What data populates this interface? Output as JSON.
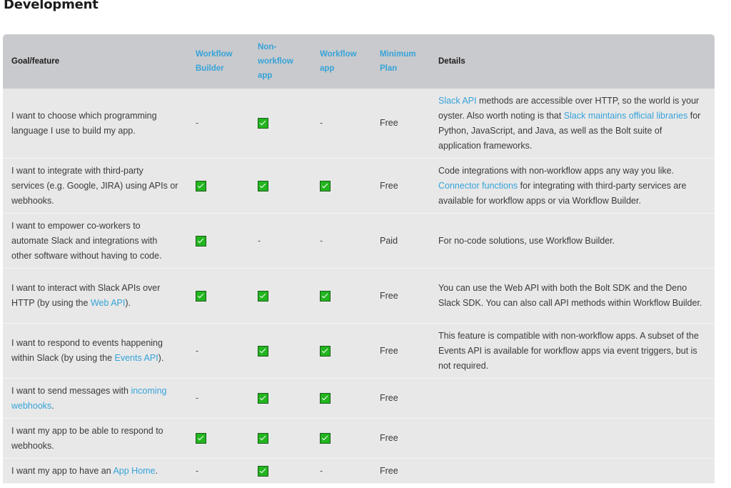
{
  "heading": "Development",
  "table": {
    "headers": {
      "goal": "Goal/feature",
      "workflow_builder": "Workflow Builder",
      "non_workflow_app": "Non-workflow app",
      "workflow_app": "Workflow app",
      "minimum_plan": "Minimum Plan",
      "details": "Details"
    },
    "rows": [
      {
        "goal": {
          "pre": "I want to choose which programming language I use to build my app.",
          "link": "",
          "post": ""
        },
        "workflow_builder": false,
        "non_workflow_app": true,
        "workflow_app": false,
        "plan": "Free",
        "details": {
          "link1": "Slack API",
          "text1": " methods are accessible over HTTP, so the world is your oyster. Also worth noting is that ",
          "link2": "Slack maintains official libraries",
          "text2": " for Python, JavaScript, and Java, as well as the Bolt suite of application frameworks."
        }
      },
      {
        "goal": {
          "pre": "I want to integrate with third-party services (e.g. Google, JIRA) using APIs or webhooks.",
          "link": "",
          "post": ""
        },
        "workflow_builder": true,
        "non_workflow_app": true,
        "workflow_app": true,
        "plan": "Free",
        "details": {
          "text0": "Code integrations with non-workflow apps any way you like. ",
          "link1": "Connector functions",
          "text1": " for integrating with third-party services are available for workflow apps or via Workflow Builder."
        }
      },
      {
        "goal": {
          "pre": "I want to empower co-workers to automate Slack and integrations with other software without having to code.",
          "link": "",
          "post": ""
        },
        "workflow_builder": true,
        "non_workflow_app": false,
        "workflow_app": false,
        "plan": "Paid",
        "details": {
          "text0": "For no-code solutions, use Workflow Builder."
        }
      },
      {
        "goal": {
          "pre": "I want to interact with Slack APIs over HTTP (by using the ",
          "link": "Web API",
          "post": ")."
        },
        "workflow_builder": true,
        "non_workflow_app": true,
        "workflow_app": true,
        "plan": "Free",
        "details": {
          "text0": "You can use the Web API with both the Bolt SDK and the Deno Slack SDK. You can also call API methods within Workflow Builder."
        }
      },
      {
        "goal": {
          "pre": "I want to respond to events happening within Slack (by using the ",
          "link": "Events API",
          "post": ")."
        },
        "workflow_builder": false,
        "non_workflow_app": true,
        "workflow_app": true,
        "plan": "Free",
        "details": {
          "text0": "This feature is compatible with non-workflow apps. A subset of the Events API is available for workflow apps via event triggers, but is not required."
        }
      },
      {
        "goal": {
          "pre": "I want to send messages with ",
          "link": "incoming webhooks",
          "post": "."
        },
        "workflow_builder": false,
        "non_workflow_app": true,
        "workflow_app": true,
        "plan": "Free",
        "details": {}
      },
      {
        "goal": {
          "pre": "I want my app to be able to respond to webhooks.",
          "link": "",
          "post": ""
        },
        "workflow_builder": true,
        "non_workflow_app": true,
        "workflow_app": true,
        "plan": "Free",
        "details": {}
      },
      {
        "goal": {
          "pre": "I want my app to have an ",
          "link": "App Home",
          "post": "."
        },
        "workflow_builder": false,
        "non_workflow_app": true,
        "workflow_app": false,
        "plan": "Free",
        "details": {}
      }
    ],
    "dash_symbol": "-",
    "check_icon": "checkbox-checked-icon",
    "colors": {
      "header_bg": "#c9cacd",
      "row_bg": "#e8e8e8",
      "link": "#36a3d9",
      "check_green": "#22b51f"
    }
  }
}
